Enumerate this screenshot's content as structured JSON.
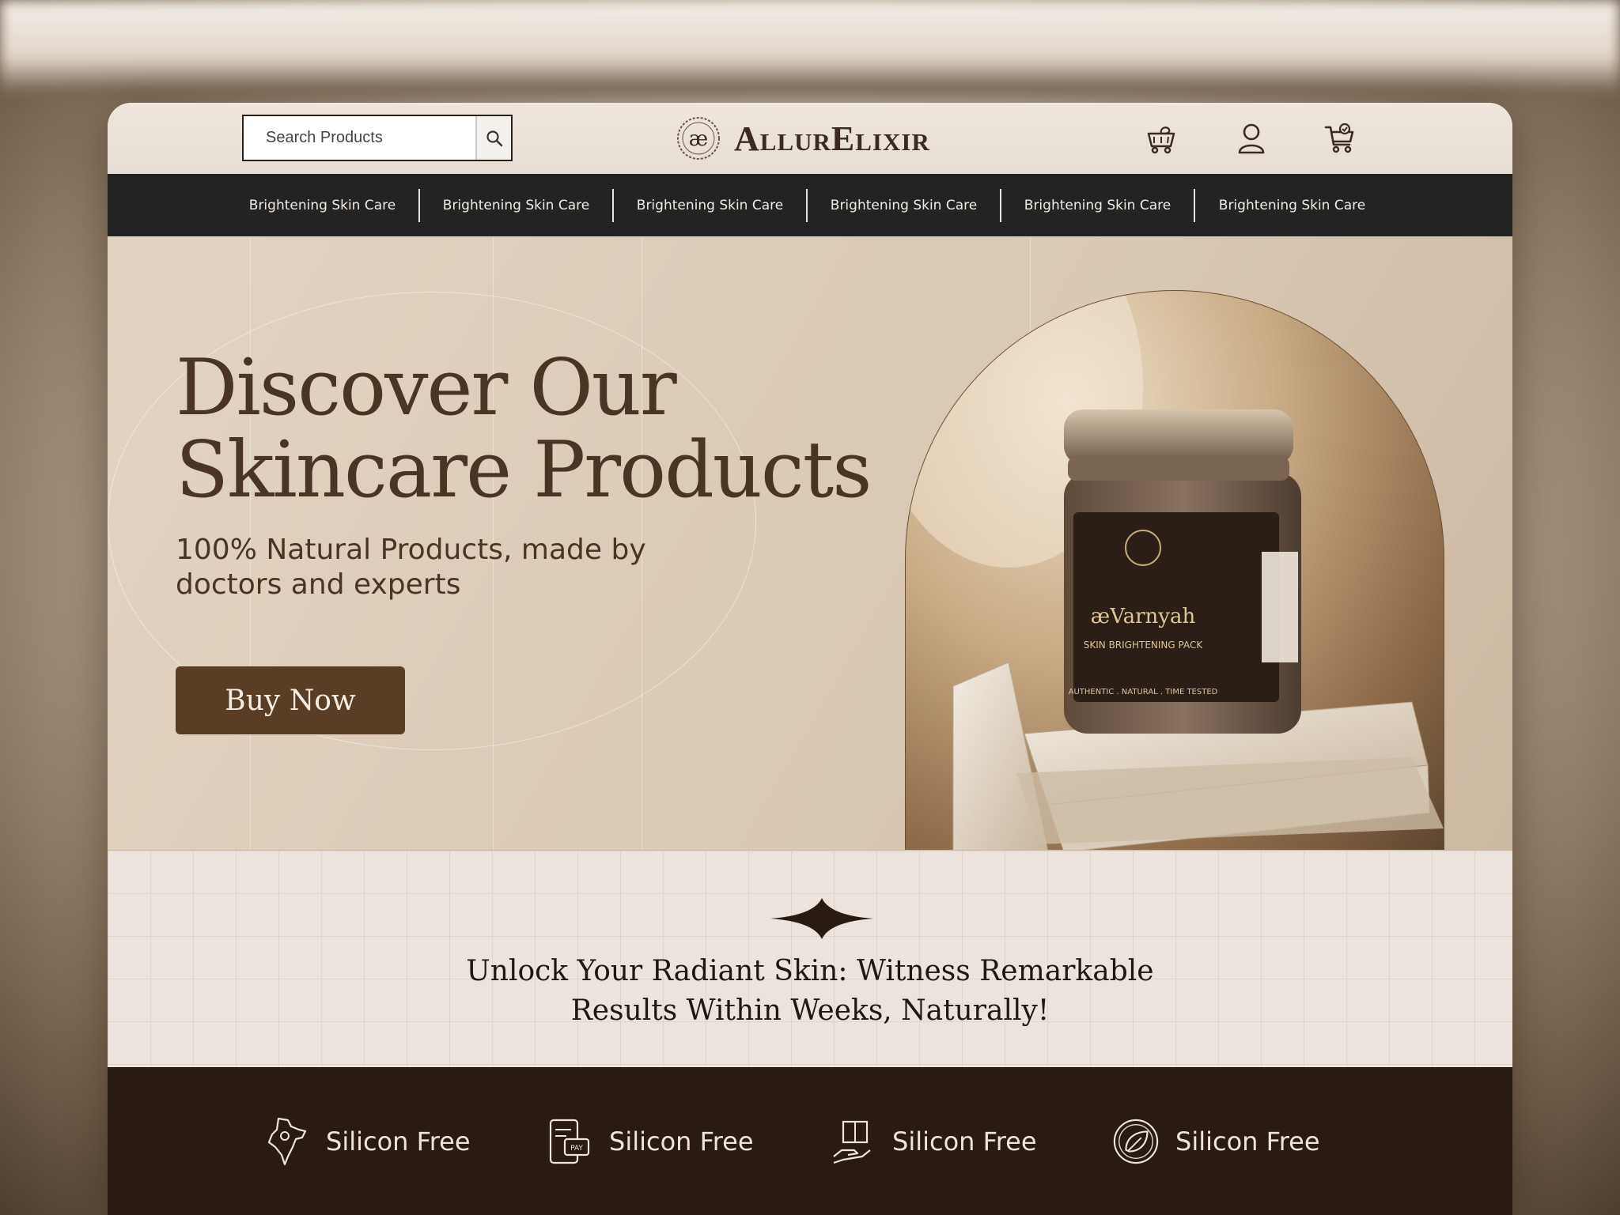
{
  "header": {
    "search_placeholder": "Search Products",
    "logo_mark": "æ",
    "brand": "AllurElixir"
  },
  "icons": {
    "search": "search-icon",
    "rewards": "gift-cart-icon",
    "account": "user-icon",
    "cart": "shopping-cart-icon"
  },
  "nav": {
    "items": [
      "Brightening Skin Care",
      "Brightening Skin Care",
      "Brightening Skin Care",
      "Brightening Skin Care",
      "Brightening Skin Care",
      "Brightening Skin Care"
    ]
  },
  "hero": {
    "title_line1": "Discover Our",
    "title_line2": "Skincare Products",
    "subtitle": "100% Natural Products, made by doctors and experts",
    "cta": "Buy Now",
    "product": {
      "brand": "æVarnyah",
      "name": "SKIN BRIGHTENING PACK",
      "tagline": "AUTHENTIC . NATURAL . TIME TESTED"
    }
  },
  "strip": {
    "tagline_line1": "Unlock Your Radiant Skin: Witness Remarkable",
    "tagline_line2": "Results Within Weeks, Naturally!"
  },
  "features": [
    {
      "label": "Silicon Free",
      "icon": "india-map-icon"
    },
    {
      "label": "Silicon Free",
      "icon": "pay-card-icon"
    },
    {
      "label": "Silicon Free",
      "icon": "hand-box-icon"
    },
    {
      "label": "Silicon Free",
      "icon": "leaf-circle-icon"
    }
  ],
  "colors": {
    "accent": "#5a3d25",
    "nav_bg": "#232323",
    "footer_bg": "#2a1b12"
  }
}
